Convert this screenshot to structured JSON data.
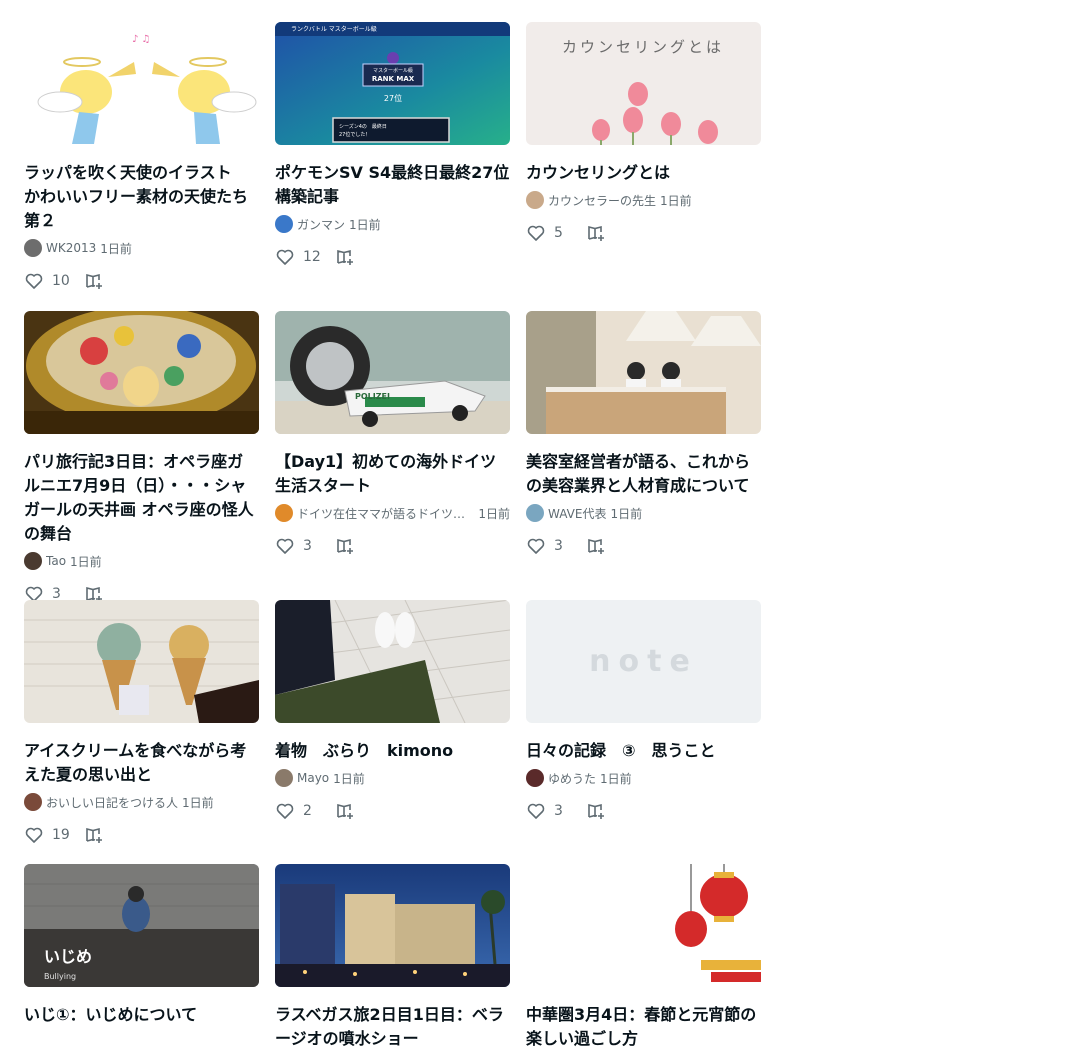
{
  "cards": [
    {
      "title": "ラッパを吹く天使のイラスト　かわいいフリー素材の天使たち　第２",
      "author": "WK2013",
      "time": "1日前",
      "likes": "10",
      "avatar_color": "#6d6d6d"
    },
    {
      "title": "ポケモンSV S4最終日最終27位 構築記事",
      "author": "ガンマン",
      "time": "1日前",
      "likes": "12",
      "avatar_color": "#3a78c9"
    },
    {
      "title": "カウンセリングとは",
      "author": "カウンセラーの先生",
      "time": "1日前",
      "likes": "5",
      "avatar_color": "#c9a98a"
    },
    {
      "title": "パリ旅行記3日目：オペラ座ガルニエ7月9日（日）・・・シャガールの天井画 オペラ座の怪人の舞台",
      "author": "Tao",
      "time": "1日前",
      "likes": "3",
      "avatar_color": "#4a3a30"
    },
    {
      "title": "【Day1】初めての海外ドイツ生活スタート",
      "author": "ドイツ在住ママが語るドイツでの子育てと暮らしのあれこれ",
      "time": "1日前",
      "likes": "3",
      "avatar_color": "#e08a2a"
    },
    {
      "title": "美容室経営者が語る、これからの美容業界と人材育成について",
      "author": "WAVE代表",
      "time": "1日前",
      "likes": "3",
      "avatar_color": "#7aa6c0"
    },
    {
      "title": "アイスクリームを食べながら考えた夏の思い出と",
      "author": "おいしい日記をつける人",
      "time": "1日前",
      "likes": "19",
      "avatar_color": "#7a4a3a"
    },
    {
      "title": "着物　ぶらり　kimono",
      "author": "Mayo",
      "time": "1日前",
      "likes": "2",
      "avatar_color": "#8a7a6a"
    },
    {
      "title": "日々の記録　③　思うこと",
      "author": "ゆめうた",
      "time": "1日前",
      "likes": "3",
      "avatar_color": "#5a2a2a"
    },
    {
      "title": "いじ①：いじめについて",
      "author": "",
      "time": "",
      "likes": "",
      "avatar_color": "#555555",
      "thumb_text": "いじめ",
      "thumb_sub": "Bullying"
    },
    {
      "title": "ラスベガス旅2日目1日目：ベラージオの噴水ショー",
      "author": "",
      "time": "",
      "likes": "",
      "avatar_color": "#555555"
    },
    {
      "title": "中華圏3月4日：春節と元宵節の楽しい過ごし方",
      "author": "",
      "time": "",
      "likes": "",
      "avatar_color": "#555555"
    }
  ],
  "thumb_texts": {
    "counseling": "カウンセリングとは",
    "ranking_header": "ランクバトル マスターボール級",
    "ranking_badge": "マスターボール級",
    "ranking_max": "RANK MAX",
    "ranking_rank": "27位",
    "ranking_msg": "シーズン4の　最終日",
    "ranking_msg2": "27位でした！",
    "police": "POLIZEI",
    "note_logo": "note"
  }
}
